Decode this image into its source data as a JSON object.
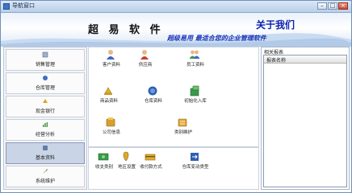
{
  "window": {
    "title": "导航窗口",
    "min": "–",
    "max": "□",
    "close": "×"
  },
  "banner": {
    "app_title": "超 易 软 件",
    "about": "关于我们",
    "slogan": "超级易用 最适合您的企业管理软件"
  },
  "sidebar": {
    "items": [
      {
        "label": "销售管理",
        "icon": "sales-icon",
        "color": "#7a8fb0"
      },
      {
        "label": "仓库管理",
        "icon": "warehouse-icon",
        "color": "#3b6fc0"
      },
      {
        "label": "现金银行",
        "icon": "bank-icon",
        "color": "#d9a520"
      },
      {
        "label": "经营分析",
        "icon": "analysis-icon",
        "color": "#4a9a4a"
      },
      {
        "label": "基本资料",
        "icon": "basic-data-icon",
        "color": "#5f7fa8"
      },
      {
        "label": "系统维护",
        "icon": "maintenance-icon",
        "color": "#5a8a3a"
      }
    ],
    "active_index": 4
  },
  "main_top": {
    "tiles": [
      {
        "label": "客户资料",
        "icon": "customer-icon"
      },
      {
        "label": "供应商",
        "icon": "supplier-icon"
      },
      {
        "label": "员工资料",
        "icon": "employee-icon"
      },
      {
        "label": "商品资料",
        "icon": "product-icon"
      },
      {
        "label": "仓库资料",
        "icon": "warehouse-data-icon"
      },
      {
        "label": "初始化入库",
        "icon": "initial-stock-icon"
      },
      {
        "label": "公司信息",
        "icon": "company-info-icon"
      },
      {
        "label": "类别维护",
        "icon": "category-icon"
      }
    ]
  },
  "main_bottom": {
    "tiles": [
      {
        "label": "收支类别",
        "icon": "income-expense-icon"
      },
      {
        "label": "地区设置",
        "icon": "region-icon"
      },
      {
        "label": "收付款方式",
        "icon": "payment-method-icon"
      },
      {
        "label": "仓库变动类型",
        "icon": "stock-change-icon"
      }
    ]
  },
  "report": {
    "title": "相关报表",
    "column": "报表名称"
  },
  "colors": {
    "accent": "#0a1fb0",
    "slogan": "#1a35b8",
    "active_bg": "#c9d4e6"
  }
}
